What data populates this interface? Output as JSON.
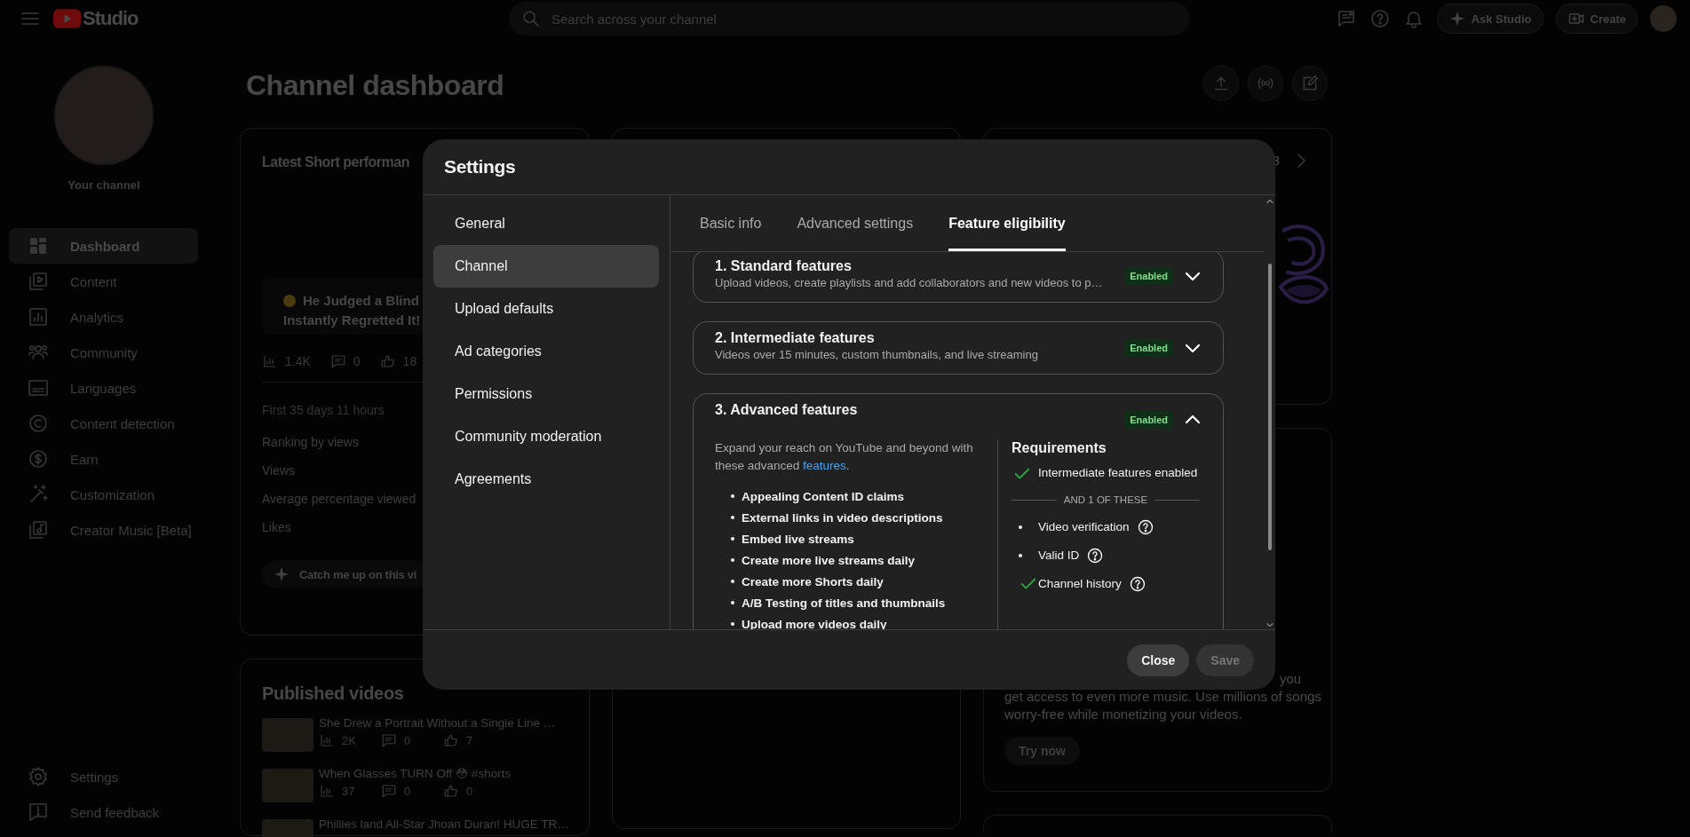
{
  "topbar": {
    "logo_text": "Studio",
    "search": {
      "placeholder": "Search across your channel"
    },
    "buttons": [
      {
        "label": "Ask Studio",
        "kind": "ask"
      },
      {
        "label": "Create",
        "kind": "create"
      }
    ]
  },
  "sidebar": {
    "channel_label": "Your channel",
    "items": [
      {
        "label": "Dashboard",
        "kind": "dashboard",
        "selected": true
      },
      {
        "label": "Content",
        "kind": "content",
        "selected": false
      },
      {
        "label": "Analytics",
        "kind": "analytics",
        "selected": false
      },
      {
        "label": "Community",
        "kind": "community",
        "selected": false
      },
      {
        "label": "Languages",
        "kind": "languages",
        "selected": false
      },
      {
        "label": "Content detection",
        "kind": "copyright",
        "selected": false
      },
      {
        "label": "Earn",
        "kind": "earn",
        "selected": false
      },
      {
        "label": "Customization",
        "kind": "customization",
        "selected": false
      },
      {
        "label": "Creator Music [Beta]",
        "kind": "music",
        "selected": false
      }
    ],
    "footer_items": [
      {
        "label": "Settings",
        "kind": "settings"
      },
      {
        "label": "Send feedback",
        "kind": "feedback"
      }
    ]
  },
  "dashboard": {
    "title": "Channel dashboard",
    "latest_short": {
      "title": "Latest Short performan",
      "video_title": [
        "He Judged a Blind",
        "Instantly Regretted It!"
      ],
      "stats": [
        {
          "kind": "views",
          "value": "1.4K"
        },
        {
          "kind": "comments",
          "value": "0"
        },
        {
          "kind": "likes",
          "value": "18"
        }
      ],
      "period": "First 35 days 11 hours",
      "metrics": [
        "Ranking by views",
        "Views",
        "Average percentage viewed",
        "Likes"
      ],
      "catch_up": "Catch me up on this vi"
    },
    "published_videos": {
      "title": "Published videos",
      "videos": [
        {
          "title": "She Drew a Portrait Without a Single Line …",
          "views": "2K",
          "comments": "0",
          "likes": "7"
        },
        {
          "title": "When Glasses TURN Off 😳 #shorts",
          "views": "37",
          "comments": "0",
          "likes": "0"
        },
        {
          "title": "Phillies land All-Star Jhoan Duran! HUGE TR…"
        }
      ]
    },
    "carousel": {
      "page": "3"
    },
    "music_promo": {
      "lines": [
        "you",
        "get access to even more music. Use millions of songs",
        "worry-free while monetizing your videos."
      ],
      "button": "Try now"
    }
  },
  "settings_dialog": {
    "title": "Settings",
    "nav": [
      {
        "label": "General",
        "selected": false
      },
      {
        "label": "Channel",
        "selected": true
      },
      {
        "label": "Upload defaults",
        "selected": false
      },
      {
        "label": "Ad categories",
        "selected": false
      },
      {
        "label": "Permissions",
        "selected": false
      },
      {
        "label": "Community moderation",
        "selected": false
      },
      {
        "label": "Agreements",
        "selected": false
      }
    ],
    "tabs": [
      {
        "label": "Basic info",
        "selected": false
      },
      {
        "label": "Advanced settings",
        "selected": false
      },
      {
        "label": "Feature eligibility",
        "selected": true
      }
    ],
    "features": [
      {
        "title": "1. Standard features",
        "description": "Upload videos, create playlists and add collaborators and new videos to p…",
        "status": "Enabled",
        "expanded": false
      },
      {
        "title": "2. Intermediate features",
        "description": "Videos over 15 minutes, custom thumbnails, and live streaming",
        "status": "Enabled",
        "expanded": false
      },
      {
        "title": "3. Advanced features",
        "status": "Enabled",
        "expanded": true,
        "details": {
          "intro": "Expand your reach on YouTube and beyond with these advanced ",
          "link": "features",
          "intro_end": ".",
          "benefits": [
            "Appealing Content ID claims",
            "External links in video descriptions",
            "Embed live streams",
            "Create more live streams daily",
            "Create more Shorts daily",
            "A/B Testing of titles and thumbnails",
            "Upload more videos daily"
          ],
          "requirements": {
            "title": "Requirements",
            "items": [
              {
                "label": "Intermediate features enabled",
                "met": true
              }
            ],
            "separator": "AND 1 OF THESE",
            "options": [
              {
                "label": "Video verification",
                "met": false
              },
              {
                "label": "Valid ID",
                "met": false
              },
              {
                "label": "Channel history",
                "met": true
              }
            ]
          }
        }
      }
    ],
    "buttons": [
      {
        "label": "Close",
        "disabled": false
      },
      {
        "label": "Save",
        "disabled": true
      }
    ]
  }
}
